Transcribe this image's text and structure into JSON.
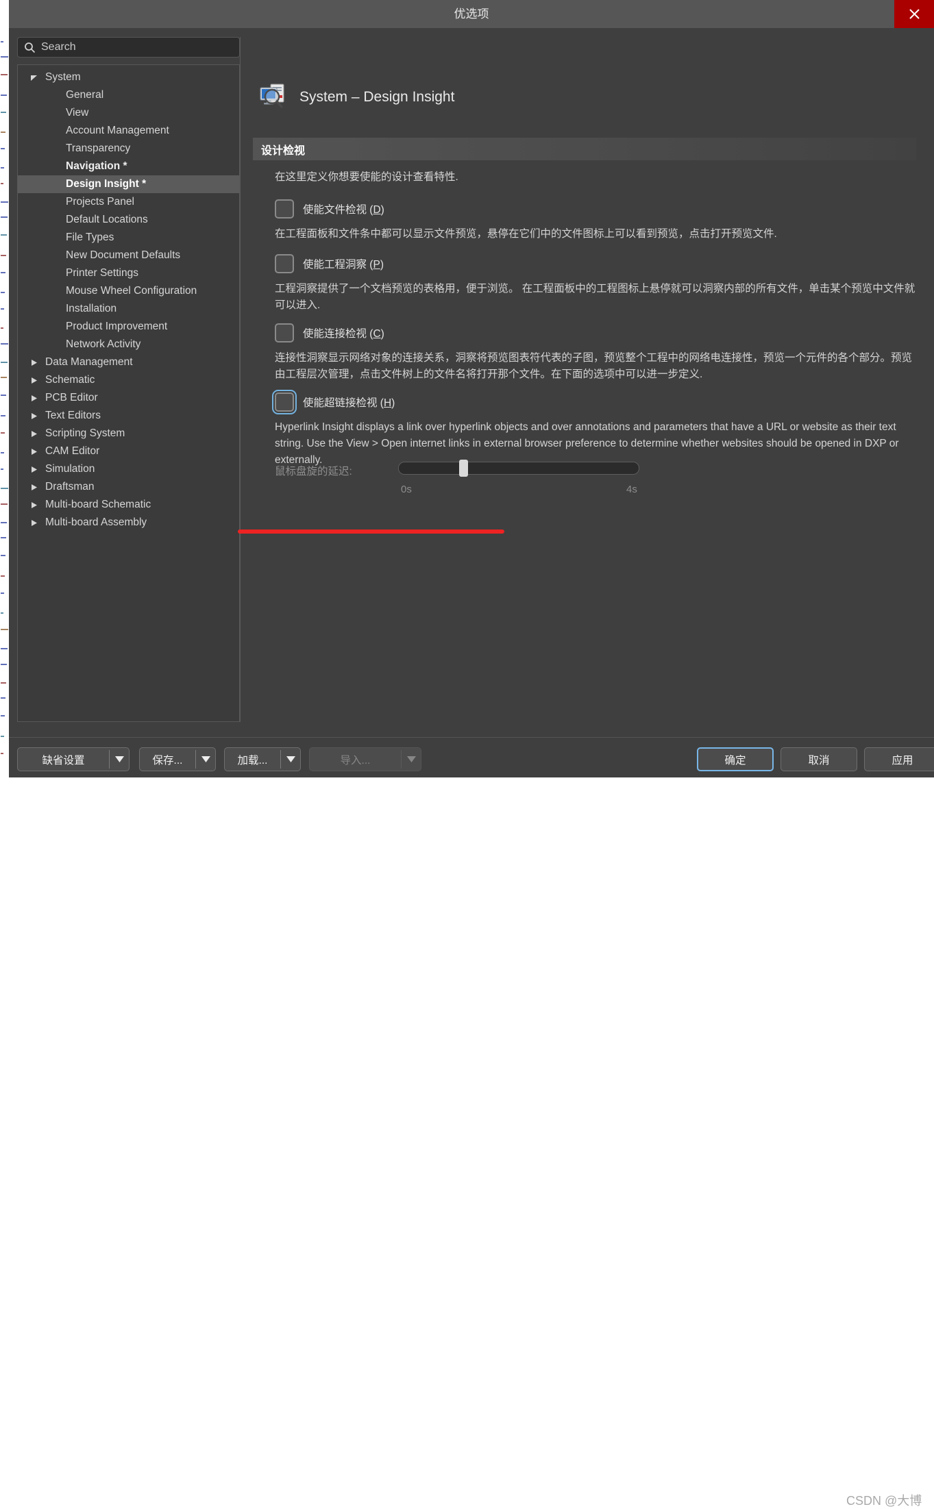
{
  "window": {
    "title": "优选项",
    "close_label": "✕"
  },
  "search": {
    "placeholder": "Search",
    "value": "",
    "icon": "search-icon"
  },
  "tree": {
    "items": [
      {
        "label": "System",
        "level": 0,
        "arrow": "expanded",
        "bold": false,
        "selected": false
      },
      {
        "label": "General",
        "level": 1,
        "arrow": "none",
        "bold": false,
        "selected": false
      },
      {
        "label": "View",
        "level": 1,
        "arrow": "none",
        "bold": false,
        "selected": false
      },
      {
        "label": "Account Management",
        "level": 1,
        "arrow": "none",
        "bold": false,
        "selected": false
      },
      {
        "label": "Transparency",
        "level": 1,
        "arrow": "none",
        "bold": false,
        "selected": false
      },
      {
        "label": "Navigation *",
        "level": 1,
        "arrow": "none",
        "bold": true,
        "selected": false
      },
      {
        "label": "Design Insight *",
        "level": 1,
        "arrow": "none",
        "bold": true,
        "selected": true
      },
      {
        "label": "Projects Panel",
        "level": 1,
        "arrow": "none",
        "bold": false,
        "selected": false
      },
      {
        "label": "Default Locations",
        "level": 1,
        "arrow": "none",
        "bold": false,
        "selected": false
      },
      {
        "label": "File Types",
        "level": 1,
        "arrow": "none",
        "bold": false,
        "selected": false
      },
      {
        "label": "New Document Defaults",
        "level": 1,
        "arrow": "none",
        "bold": false,
        "selected": false
      },
      {
        "label": "Printer Settings",
        "level": 1,
        "arrow": "none",
        "bold": false,
        "selected": false
      },
      {
        "label": "Mouse Wheel Configuration",
        "level": 1,
        "arrow": "none",
        "bold": false,
        "selected": false
      },
      {
        "label": "Installation",
        "level": 1,
        "arrow": "none",
        "bold": false,
        "selected": false
      },
      {
        "label": "Product Improvement",
        "level": 1,
        "arrow": "none",
        "bold": false,
        "selected": false
      },
      {
        "label": "Network Activity",
        "level": 1,
        "arrow": "none",
        "bold": false,
        "selected": false
      },
      {
        "label": "Data Management",
        "level": 0,
        "arrow": "collapsed",
        "bold": false,
        "selected": false
      },
      {
        "label": "Schematic",
        "level": 0,
        "arrow": "collapsed",
        "bold": false,
        "selected": false
      },
      {
        "label": "PCB Editor",
        "level": 0,
        "arrow": "collapsed",
        "bold": false,
        "selected": false
      },
      {
        "label": "Text Editors",
        "level": 0,
        "arrow": "collapsed",
        "bold": false,
        "selected": false
      },
      {
        "label": "Scripting System",
        "level": 0,
        "arrow": "collapsed",
        "bold": false,
        "selected": false
      },
      {
        "label": "CAM Editor",
        "level": 0,
        "arrow": "collapsed",
        "bold": false,
        "selected": false
      },
      {
        "label": "Simulation",
        "level": 0,
        "arrow": "collapsed",
        "bold": false,
        "selected": false
      },
      {
        "label": "Draftsman",
        "level": 0,
        "arrow": "collapsed",
        "bold": false,
        "selected": false
      },
      {
        "label": "Multi-board Schematic",
        "level": 0,
        "arrow": "collapsed",
        "bold": false,
        "selected": false
      },
      {
        "label": "Multi-board Assembly",
        "level": 0,
        "arrow": "collapsed",
        "bold": false,
        "selected": false
      }
    ]
  },
  "page": {
    "icon": "design-insight-icon",
    "title": "System – Design Insight",
    "section_title": "设计检视",
    "intro": "在这里定义你想要使能的设计查看特性.",
    "options": [
      {
        "label_prefix": "使能文件检视 (",
        "accelerator": "D",
        "label_suffix": ")",
        "checked": false,
        "focused": false,
        "description": "在工程面板和文件条中都可以显示文件预览，悬停在它们中的文件图标上可以看到预览，点击打开预览文件."
      },
      {
        "label_prefix": "使能工程洞察 (",
        "accelerator": "P",
        "label_suffix": ")",
        "checked": false,
        "focused": false,
        "description": "工程洞察提供了一个文档预览的表格用，便于浏览。 在工程面板中的工程图标上悬停就可以洞察内部的所有文件，单击某个预览中文件就可以进入."
      },
      {
        "label_prefix": "使能连接检视 (",
        "accelerator": "C",
        "label_suffix": ")",
        "checked": false,
        "focused": false,
        "description": "连接性洞察显示网络对象的连接关系，洞察将预览图表符代表的子图，预览整个工程中的网络电连接性，预览一个元件的各个部分。预览由工程层次管理，点击文件树上的文件名将打开那个文件。在下面的选项中可以进一步定义."
      },
      {
        "label_prefix": "使能超链接检视 (",
        "accelerator": "H",
        "label_suffix": ")",
        "checked": false,
        "focused": true,
        "description": "Hyperlink Insight displays a link over hyperlink objects and over annotations and parameters that have a URL or website as their text string. Use the View > Open internet links in external browser preference to determine whether websites should be opened in DXP or externally."
      }
    ],
    "slider": {
      "label": "鼠标盘旋的延迟:",
      "min_tick": "0s",
      "max_tick": "4s",
      "value_percent": 26,
      "disabled": true
    }
  },
  "annotation": {
    "color": "#ee2222"
  },
  "footer": {
    "split_buttons": [
      {
        "label": "缺省设置",
        "caret": "chevron-down-icon",
        "disabled": false
      },
      {
        "label": "保存...",
        "caret": "chevron-down-icon",
        "disabled": false
      },
      {
        "label": "加载...",
        "caret": "chevron-down-icon",
        "disabled": false
      },
      {
        "label": "导入...",
        "caret": "chevron-down-icon",
        "disabled": true
      }
    ],
    "ok_label": "确定",
    "cancel_label": "取消",
    "apply_label": "应用"
  },
  "watermark": {
    "text": "CSDN @大博"
  },
  "colors": {
    "accent": "#78b6e8",
    "close_button": "#aa0000",
    "annotation_red": "#ee2222",
    "dialog_bg": "#3f3f3f",
    "titlebar_bg": "#565656",
    "selection_bg": "#5b5b5b"
  }
}
